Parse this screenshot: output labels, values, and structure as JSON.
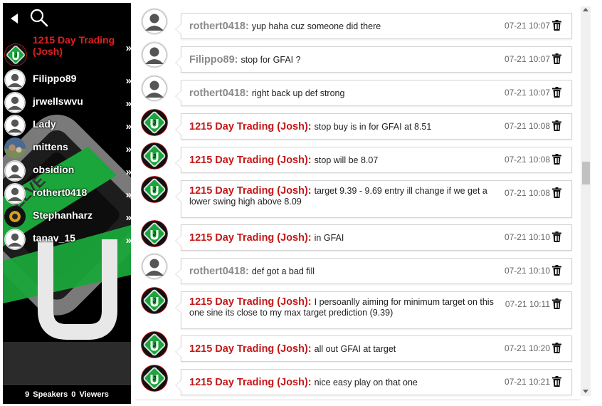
{
  "sidebar": {
    "users": [
      {
        "name": "1215 Day Trading (Josh)",
        "avatar": "logo-avatar",
        "featured": true
      },
      {
        "name": "Filippo89",
        "avatar": "default-avatar"
      },
      {
        "name": "jrwellswvu",
        "avatar": "default-avatar"
      },
      {
        "name": "Lady",
        "avatar": "default-avatar"
      },
      {
        "name": "mittens",
        "avatar": "photo-avatar"
      },
      {
        "name": "obsidion",
        "avatar": "default-avatar"
      },
      {
        "name": "rothert0418",
        "avatar": "default-avatar"
      },
      {
        "name": "Stephanharz",
        "avatar": "dark-avatar"
      },
      {
        "name": "tanav_15",
        "avatar": "default-avatar"
      }
    ],
    "chevron": "»",
    "footer": {
      "speakers_count": "9",
      "speakers_label": "Speakers",
      "viewers_count": "0",
      "viewers_label": "Viewers"
    }
  },
  "messages": [
    {
      "sender": "rothert0418:",
      "role": "user",
      "text": "yup haha cuz someone did there",
      "time": "07-21 10:07"
    },
    {
      "sender": "Filippo89:",
      "role": "user",
      "text": "stop for GFAI ?",
      "time": "07-21 10:07"
    },
    {
      "sender": "rothert0418:",
      "role": "user",
      "text": "right back up def strong",
      "time": "07-21 10:07"
    },
    {
      "sender": "1215 Day Trading (Josh):",
      "role": "mod",
      "text": "stop buy is in for GFAI at 8.51",
      "time": "07-21 10:08"
    },
    {
      "sender": "1215 Day Trading (Josh):",
      "role": "mod",
      "text": "stop will be 8.07",
      "time": "07-21 10:08"
    },
    {
      "sender": "1215 Day Trading (Josh):",
      "role": "mod",
      "text": "target 9.39 - 9.69 entry ill change if we get a lower swing high above 8.09",
      "time": "07-21 10:08"
    },
    {
      "sender": "1215 Day Trading (Josh):",
      "role": "mod",
      "text": "in GFAI",
      "time": "07-21 10:10"
    },
    {
      "sender": "rothert0418:",
      "role": "user",
      "text": "def got a bad fill",
      "time": "07-21 10:10"
    },
    {
      "sender": "1215 Day Trading (Josh):",
      "role": "mod",
      "text": "I persoanlly aiming for minimum target on this one sine its close to my max target prediction (9.39)",
      "time": "07-21 10:11"
    },
    {
      "sender": "1215 Day Trading (Josh):",
      "role": "mod",
      "text": "all out GFAI at target",
      "time": "07-21 10:20"
    },
    {
      "sender": "1215 Day Trading (Josh):",
      "role": "mod",
      "text": "nice easy play on that one",
      "time": "07-21 10:21"
    }
  ],
  "colors": {
    "mod_name": "#c31818",
    "user_name": "#8a8a8a",
    "featured_user": "#e02020",
    "logo_green": "#1aa63a"
  }
}
